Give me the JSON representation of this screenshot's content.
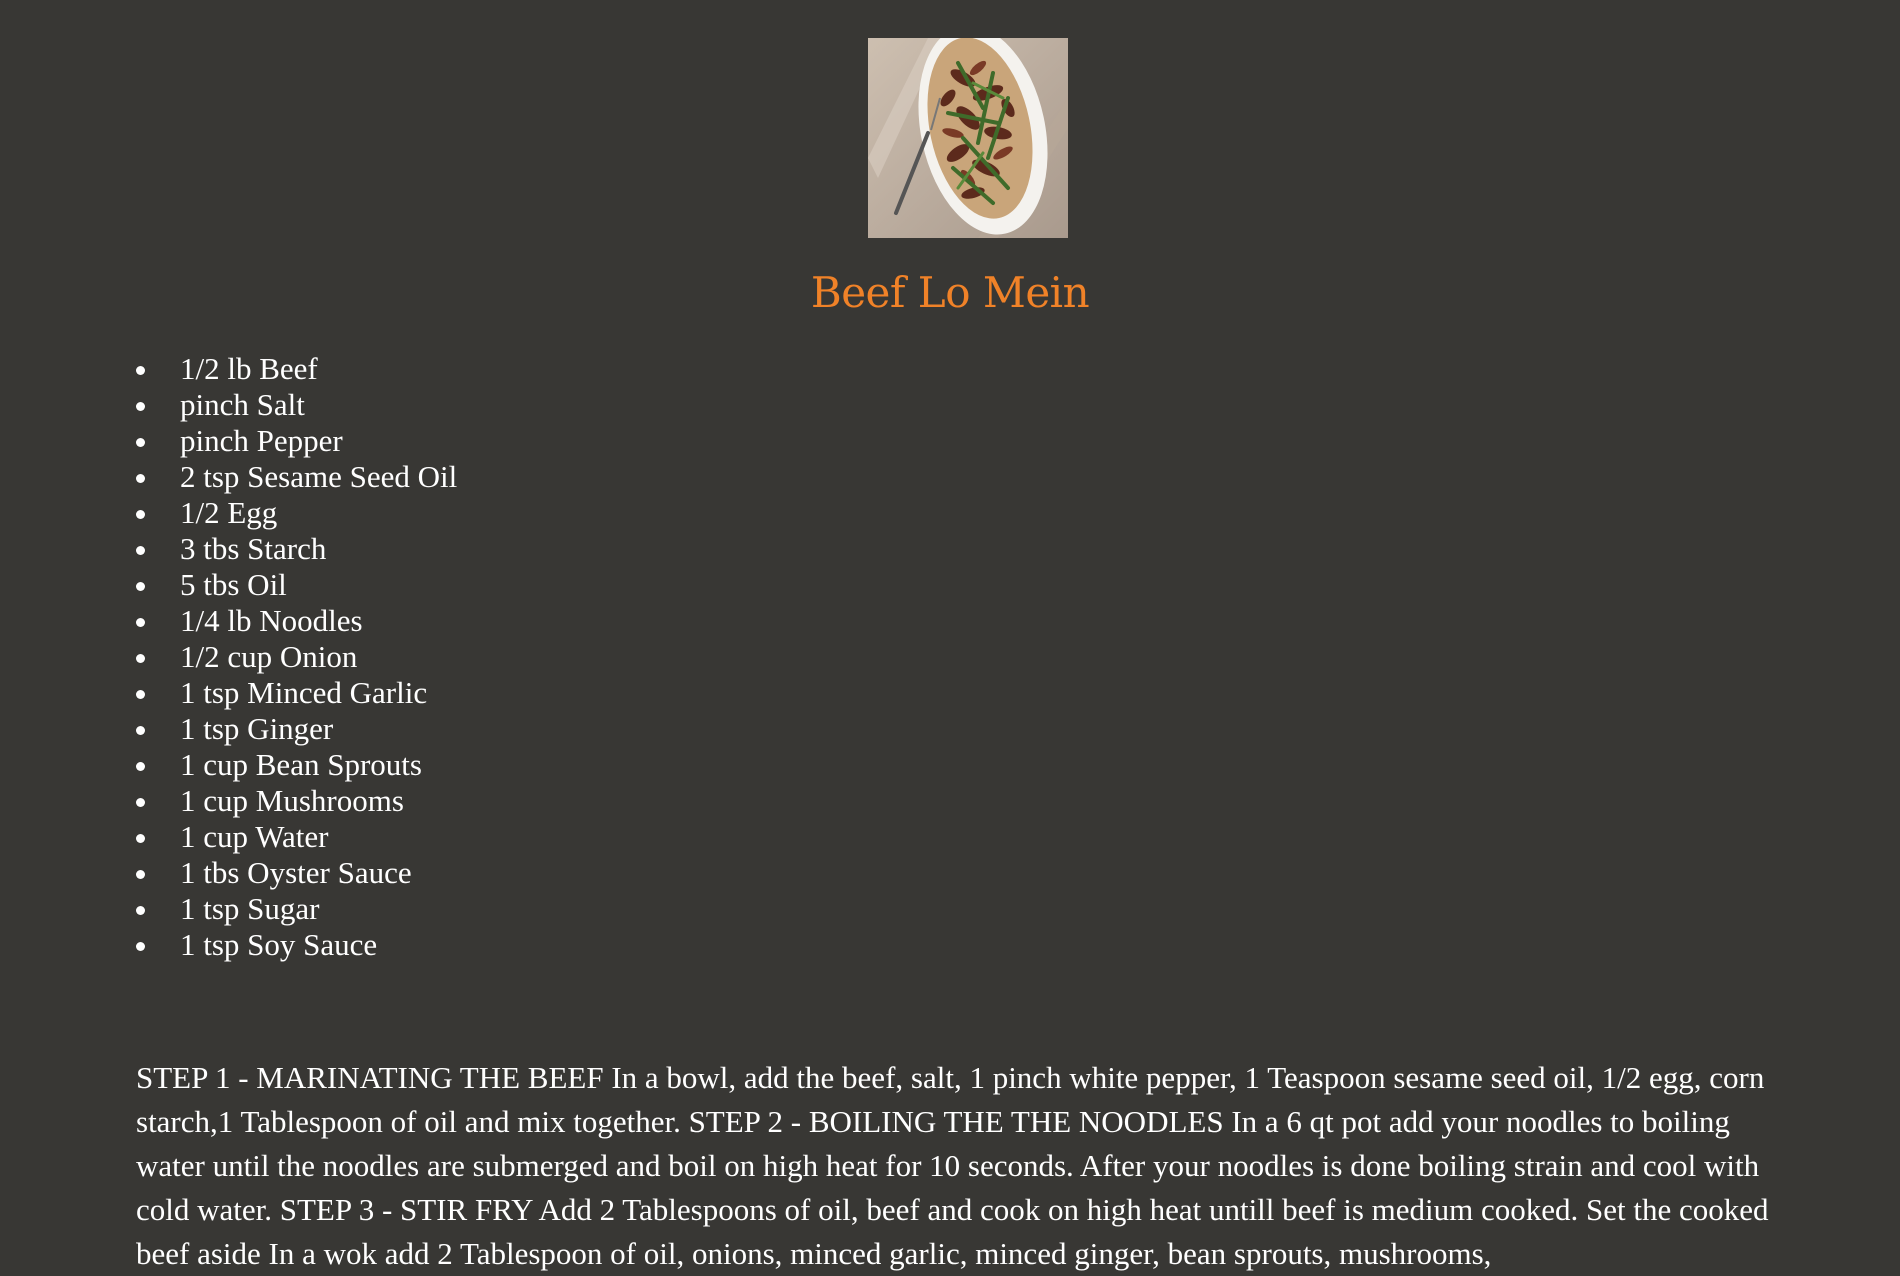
{
  "recipe": {
    "image_alt": "Beef Lo Mein dish",
    "title": "Beef Lo Mein",
    "ingredients": [
      "1/2 lb Beef",
      "pinch Salt",
      "pinch Pepper",
      "2 tsp Sesame Seed Oil",
      "1/2 Egg",
      "3 tbs Starch",
      "5 tbs Oil",
      "1/4 lb Noodles",
      "1/2 cup Onion",
      "1 tsp Minced Garlic",
      "1 tsp Ginger",
      "1 cup Bean Sprouts",
      "1 cup Mushrooms",
      "1 cup Water",
      "1 tbs Oyster Sauce",
      "1 tsp Sugar",
      "1 tsp Soy Sauce"
    ],
    "instructions": "STEP 1 - MARINATING THE BEEF In a bowl, add the beef, salt, 1 pinch white pepper, 1 Teaspoon sesame seed oil, 1/2 egg, corn starch,1 Tablespoon of oil and mix together. STEP 2 - BOILING THE THE NOODLES In a 6 qt pot add your noodles to boiling water until the noodles are submerged and boil on high heat for 10 seconds. After your noodles is done boiling strain and cool with cold water. STEP 3 - STIR FRY Add 2 Tablespoons of oil, beef and cook on high heat untill beef is medium cooked. Set the cooked beef aside In a wok add 2 Tablespoon of oil, onions, minced garlic, minced ginger, bean sprouts, mushrooms,"
  },
  "colors": {
    "background": "#383734",
    "title": "#f08228",
    "text": "#ffffff"
  }
}
